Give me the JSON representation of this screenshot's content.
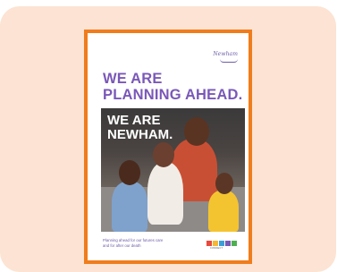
{
  "poster": {
    "logo_text": "Newham",
    "headline_line1": "WE ARE",
    "headline_line2": "PLANNING AHEAD.",
    "overlay_line1": "WE ARE",
    "overlay_line2": "NEWHAM.",
    "footer_line1": "Planning ahead for our futures care",
    "footer_line2": "and for after our death",
    "badge_caption": "CONNECT",
    "colors": {
      "background": "#fce3d3",
      "border": "#f07c1c",
      "headline": "#7a58b8"
    }
  }
}
